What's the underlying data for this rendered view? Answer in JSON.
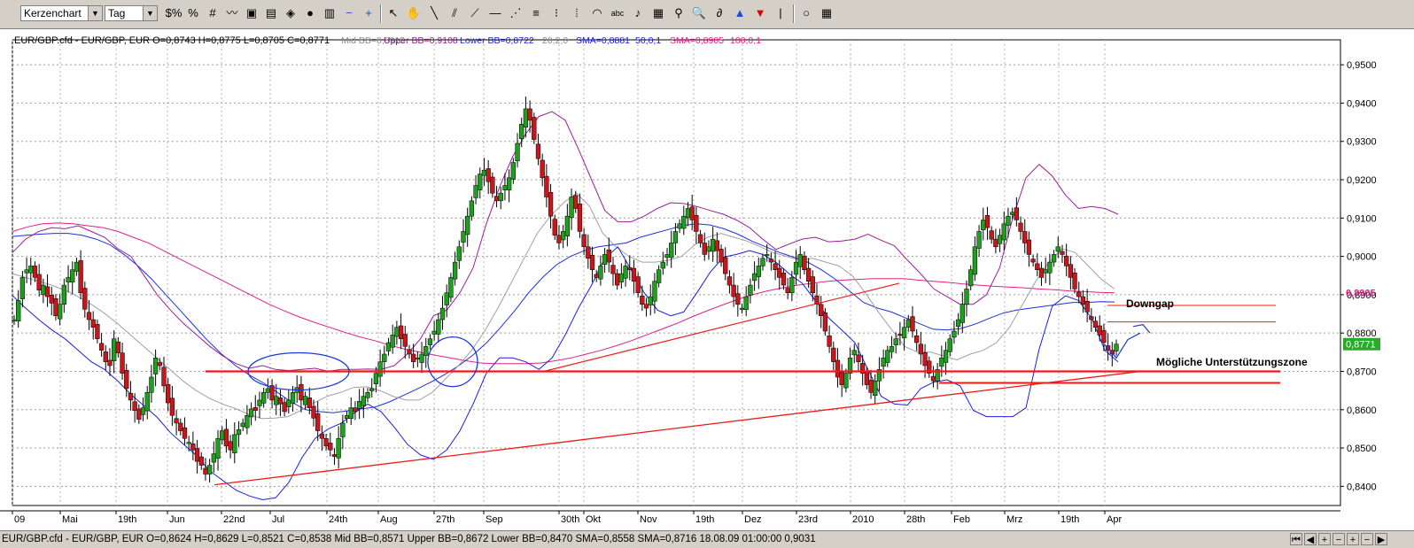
{
  "toolbar": {
    "chart_type": "Kerzenchart",
    "period": "Tag",
    "tools": [
      {
        "name": "dollar-tool-icon",
        "glyph": "$%"
      },
      {
        "name": "percent-tool-icon",
        "glyph": "%"
      },
      {
        "name": "grid-tool-icon",
        "glyph": "#"
      },
      {
        "name": "line-chart-icon",
        "glyph": "〰"
      },
      {
        "name": "print-icon",
        "glyph": "▣"
      },
      {
        "name": "image-icon",
        "glyph": "▤"
      },
      {
        "name": "eraser-icon",
        "glyph": "◈"
      },
      {
        "name": "palette-icon",
        "glyph": "●"
      },
      {
        "name": "chart-settings-icon",
        "glyph": "▥"
      },
      {
        "name": "zoom-out-icon",
        "glyph": "−"
      },
      {
        "name": "zoom-in-icon",
        "glyph": "+"
      },
      {
        "name": "pointer-icon",
        "glyph": "↖"
      },
      {
        "name": "hand-icon",
        "glyph": "✋"
      },
      {
        "name": "trendline-icon",
        "glyph": "╲"
      },
      {
        "name": "parallel-lines-icon",
        "glyph": "⫽"
      },
      {
        "name": "channel-icon",
        "glyph": "⟋"
      },
      {
        "name": "horizontal-line-icon",
        "glyph": "—"
      },
      {
        "name": "fan-icon",
        "glyph": "⋰"
      },
      {
        "name": "speed-lines-icon",
        "glyph": "≡"
      },
      {
        "name": "retracement-icon",
        "glyph": "⁝"
      },
      {
        "name": "fibonacci-icon",
        "glyph": "⦙"
      },
      {
        "name": "arc-icon",
        "glyph": "◠"
      },
      {
        "name": "text-tool-icon",
        "glyph": "abc"
      },
      {
        "name": "alarm-bell-icon",
        "glyph": "♪"
      },
      {
        "name": "calculator-icon",
        "glyph": "▦"
      },
      {
        "name": "search-icon",
        "glyph": "⚲"
      },
      {
        "name": "magnifier-icon",
        "glyph": "🔍"
      },
      {
        "name": "lasso-icon",
        "glyph": "∂"
      },
      {
        "name": "arrow-up-icon",
        "glyph": "▲"
      },
      {
        "name": "arrow-down-icon",
        "glyph": "▼"
      },
      {
        "name": "cursor-bar-icon",
        "glyph": "|"
      },
      {
        "name": "circle-icon",
        "glyph": "○"
      },
      {
        "name": "color-grid-icon",
        "glyph": "▦"
      }
    ]
  },
  "chart_data": {
    "type": "candlestick",
    "header": {
      "symbol_text": "EUR/GBP.cfd - EUR/GBP, EUR O=0,8743 H=0,8775 L=0,8705 C=0,8771",
      "midbb": "Mid BB=0,8915",
      "upperbb": "Upper BB=0,9108",
      "lowerbb": "Lower BB=0,8722",
      "bbparams": "20,2,0",
      "sma50": "SMA=0,8881",
      "sma50params": "50,0,1",
      "sma100": "SMA=0,8905",
      "sma100params": "100,0,1"
    },
    "y_range": [
      0.835,
      0.9565
    ],
    "y_ticks": [
      "0,8400",
      "0,8500",
      "0,8600",
      "0,8700",
      "0,8800",
      "0,8900",
      "0,9000",
      "0,9100",
      "0,9200",
      "0,9300",
      "0,9400",
      "0,9500"
    ],
    "x_labels": [
      "09",
      "Mai",
      "19th",
      "Jun",
      "22nd",
      "Jul",
      "24th",
      "Aug",
      "27th",
      "Sep",
      "30th",
      "Okt",
      "Nov",
      "19th",
      "Dez",
      "23rd",
      "2010",
      "28th",
      "Feb",
      "Mrz",
      "19th",
      "Apr"
    ],
    "price_marker_sma100": "0,8905",
    "price_marker_last": "0,8771",
    "annotations": {
      "downgap": "Downgap",
      "support": "Mögliche Unterstützungszone"
    },
    "bb_upper": [
      0.901,
      0.9045,
      0.9065,
      0.9075,
      0.9072,
      0.908,
      0.9065,
      0.905,
      0.902,
      0.9,
      0.895,
      0.89,
      0.886,
      0.8825,
      0.8795,
      0.8765,
      0.874,
      0.872,
      0.8708,
      0.8715,
      0.8705,
      0.8702,
      0.8705,
      0.8708,
      0.87,
      0.8705,
      0.8705,
      0.8706,
      0.8705,
      0.8715,
      0.8745,
      0.8785,
      0.8845,
      0.886,
      0.8905,
      0.897,
      0.9085,
      0.918,
      0.926,
      0.932,
      0.9365,
      0.9378,
      0.9355,
      0.928,
      0.92,
      0.912,
      0.909,
      0.909,
      0.9105,
      0.9125,
      0.914,
      0.9138,
      0.913,
      0.912,
      0.911,
      0.9095,
      0.9075,
      0.9045,
      0.9018,
      0.9032,
      0.9045,
      0.905,
      0.9038,
      0.904,
      0.9045,
      0.9058,
      0.9042,
      0.9028,
      0.899,
      0.8955,
      0.8915,
      0.8895,
      0.8875,
      0.8875,
      0.89,
      0.897,
      0.91,
      0.9205,
      0.924,
      0.921,
      0.916,
      0.9125,
      0.913,
      0.9125,
      0.911
    ],
    "bb_lower": [
      0.8898,
      0.8865,
      0.8835,
      0.8808,
      0.8785,
      0.8755,
      0.8725,
      0.8705,
      0.8675,
      0.864,
      0.861,
      0.858,
      0.854,
      0.851,
      0.848,
      0.844,
      0.8415,
      0.839,
      0.8375,
      0.8365,
      0.837,
      0.841,
      0.8475,
      0.8525,
      0.855,
      0.8565,
      0.8592,
      0.8615,
      0.8595,
      0.8555,
      0.851,
      0.8482,
      0.847,
      0.8495,
      0.8545,
      0.8615,
      0.8695,
      0.8735,
      0.8735,
      0.8725,
      0.8705,
      0.8735,
      0.8795,
      0.8865,
      0.8925,
      0.8995,
      0.9025,
      0.8965,
      0.8905,
      0.886,
      0.8845,
      0.8855,
      0.8905,
      0.8958,
      0.8998,
      0.9005,
      0.9015,
      0.9005,
      0.8985,
      0.8955,
      0.893,
      0.8885,
      0.884,
      0.8808,
      0.8775,
      0.8705,
      0.8635,
      0.8615,
      0.8612,
      0.8655,
      0.8672,
      0.8678,
      0.8662,
      0.8598,
      0.8582,
      0.8582,
      0.8582,
      0.8605,
      0.8758,
      0.887,
      0.8897,
      0.8885,
      0.8838,
      0.8755,
      0.8725
    ],
    "bb_mid": [
      0.8955,
      0.8945,
      0.8935,
      0.8925,
      0.8912,
      0.8895,
      0.8875,
      0.8852,
      0.8825,
      0.8795,
      0.8765,
      0.8735,
      0.8705,
      0.8675,
      0.865,
      0.863,
      0.8615,
      0.8603,
      0.8588,
      0.8577,
      0.8578,
      0.8582,
      0.8598,
      0.8618,
      0.8635,
      0.8645,
      0.8658,
      0.866,
      0.865,
      0.8635,
      0.8625,
      0.8625,
      0.8645,
      0.868,
      0.8715,
      0.8755,
      0.8805,
      0.8865,
      0.893,
      0.8995,
      0.906,
      0.9105,
      0.914,
      0.9165,
      0.913,
      0.906,
      0.9025,
      0.9,
      0.8985,
      0.8985,
      0.899,
      0.9,
      0.903,
      0.905,
      0.906,
      0.905,
      0.904,
      0.9025,
      0.901,
      0.9,
      0.899,
      0.8995,
      0.8985,
      0.8975,
      0.895,
      0.8905,
      0.8855,
      0.881,
      0.8765,
      0.875,
      0.875,
      0.874,
      0.873,
      0.8745,
      0.8755,
      0.8775,
      0.8815,
      0.8875,
      0.8935,
      0.8985,
      0.902,
      0.901,
      0.8975,
      0.894,
      0.8915
    ],
    "sma50": [
      0.9052,
      0.9055,
      0.9058,
      0.906,
      0.906,
      0.9055,
      0.9045,
      0.903,
      0.9005,
      0.8975,
      0.894,
      0.89,
      0.886,
      0.882,
      0.878,
      0.8745,
      0.8715,
      0.869,
      0.867,
      0.8645,
      0.862,
      0.86,
      0.8595,
      0.8592,
      0.8597,
      0.8602,
      0.8607,
      0.862,
      0.8637,
      0.8654,
      0.8672,
      0.8692,
      0.8715,
      0.8742,
      0.8775,
      0.8815,
      0.8858,
      0.8905,
      0.8945,
      0.8978,
      0.9,
      0.9015,
      0.9025,
      0.903,
      0.9035,
      0.905,
      0.906,
      0.907,
      0.908,
      0.9085,
      0.9082,
      0.9072,
      0.9058,
      0.904,
      0.9025,
      0.901,
      0.8998,
      0.8985,
      0.8965,
      0.894,
      0.891,
      0.888,
      0.8865,
      0.8855,
      0.884,
      0.8825,
      0.881,
      0.8808,
      0.8812,
      0.8823,
      0.8838,
      0.8852,
      0.886,
      0.8865,
      0.887,
      0.8875,
      0.888,
      0.888,
      0.8882,
      0.8881
    ],
    "sma100": [
      0.9065,
      0.9077,
      0.9085,
      0.9087,
      0.9085,
      0.908,
      0.9075,
      0.9065,
      0.905,
      0.9035,
      0.9015,
      0.8995,
      0.8975,
      0.8955,
      0.8935,
      0.8915,
      0.8895,
      0.8875,
      0.8858,
      0.8842,
      0.8828,
      0.8815,
      0.8802,
      0.879,
      0.878,
      0.8768,
      0.8758,
      0.875,
      0.8742,
      0.8735,
      0.8728,
      0.8722,
      0.872,
      0.872,
      0.872,
      0.8722,
      0.8728,
      0.8735,
      0.8745,
      0.8755,
      0.8767,
      0.878,
      0.8795,
      0.881,
      0.8825,
      0.8842,
      0.8858,
      0.8873,
      0.8887,
      0.89,
      0.891,
      0.8918,
      0.8925,
      0.893,
      0.8935,
      0.8938,
      0.894,
      0.8942,
      0.8942,
      0.8942,
      0.8938,
      0.8935,
      0.8932,
      0.8928,
      0.8925,
      0.8922,
      0.892,
      0.8918,
      0.8915,
      0.8913,
      0.891,
      0.8908,
      0.8906,
      0.8905
    ],
    "closes": [
      0.8835,
      0.8885,
      0.8945,
      0.8965,
      0.8975,
      0.8945,
      0.8912,
      0.8925,
      0.8895,
      0.8878,
      0.8845,
      0.8875,
      0.8925,
      0.8945,
      0.8965,
      0.8985,
      0.8905,
      0.8862,
      0.8835,
      0.8815,
      0.8785,
      0.8755,
      0.8725,
      0.8715,
      0.8785,
      0.8748,
      0.8695,
      0.8655,
      0.8625,
      0.8598,
      0.8575,
      0.8605,
      0.8645,
      0.8685,
      0.8735,
      0.8715,
      0.8662,
      0.8618,
      0.8585,
      0.8565,
      0.8545,
      0.8525,
      0.8515,
      0.8495,
      0.8465,
      0.8455,
      0.8432,
      0.8455,
      0.8485,
      0.8525,
      0.8545,
      0.8505,
      0.8495,
      0.8535,
      0.8548,
      0.8565,
      0.8585,
      0.8602,
      0.8598,
      0.8625,
      0.8645,
      0.8655,
      0.8625,
      0.8635,
      0.8615,
      0.8595,
      0.8625,
      0.8645,
      0.8658,
      0.8625,
      0.8635,
      0.8605,
      0.8578,
      0.8545,
      0.8525,
      0.8505,
      0.8495,
      0.8478,
      0.8525,
      0.8565,
      0.8585,
      0.8605,
      0.8595,
      0.8622,
      0.8635,
      0.8645,
      0.8655,
      0.8695,
      0.8725,
      0.8745,
      0.8775,
      0.8795,
      0.8815,
      0.8785,
      0.8765,
      0.8745,
      0.8725,
      0.8735,
      0.8745,
      0.8765,
      0.8785,
      0.8805,
      0.8835,
      0.8865,
      0.8905,
      0.8945,
      0.8985,
      0.9025,
      0.9065,
      0.9105,
      0.9145,
      0.9185,
      0.9215,
      0.9225,
      0.9195,
      0.9165,
      0.9145,
      0.9165,
      0.9185,
      0.9205,
      0.9245,
      0.9295,
      0.9345,
      0.9385,
      0.9355,
      0.9305,
      0.9255,
      0.9205,
      0.9155,
      0.9105,
      0.9055,
      0.9035,
      0.9065,
      0.9105,
      0.9155,
      0.9125,
      0.9065,
      0.9025,
      0.8995,
      0.8965,
      0.8945,
      0.8975,
      0.9005,
      0.8985,
      0.8955,
      0.8925,
      0.8955,
      0.8975,
      0.8965,
      0.8935,
      0.8905,
      0.8875,
      0.8865,
      0.8895,
      0.8935,
      0.8965,
      0.8985,
      0.9005,
      0.9035,
      0.9065,
      0.9085,
      0.9105,
      0.9125,
      0.9095,
      0.9065,
      0.9035,
      0.9005,
      0.9025,
      0.9045,
      0.9015,
      0.8985,
      0.8955,
      0.8925,
      0.8895,
      0.8875,
      0.8865,
      0.8895,
      0.8925,
      0.8955,
      0.8975,
      0.8995,
      0.9005,
      0.8985,
      0.8965,
      0.8945,
      0.8925,
      0.8905,
      0.8945,
      0.8985,
      0.9005,
      0.8965,
      0.8935,
      0.8905,
      0.8875,
      0.8845,
      0.8805,
      0.8765,
      0.8725,
      0.8685,
      0.8665,
      0.8695,
      0.8735,
      0.8755,
      0.8725,
      0.8695,
      0.8665,
      0.8645,
      0.8675,
      0.8705,
      0.8735,
      0.8755,
      0.8765,
      0.8785,
      0.8795,
      0.8815,
      0.8835,
      0.8805,
      0.8775,
      0.8745,
      0.8715,
      0.8695,
      0.8675,
      0.8705,
      0.8735,
      0.8755,
      0.8785,
      0.8805,
      0.8835,
      0.8875,
      0.8915,
      0.8965,
      0.9025,
      0.9065,
      0.9095,
      0.9075,
      0.9045,
      0.9025,
      0.9055,
      0.9085,
      0.9105,
      0.9115,
      0.9095,
      0.9065,
      0.9035,
      0.9005,
      0.8985,
      0.8965,
      0.8945,
      0.8965,
      0.8985,
      0.9005,
      0.9025,
      0.9005,
      0.8975,
      0.8945,
      0.8915,
      0.8895,
      0.8875,
      0.8855,
      0.8835,
      0.8815,
      0.8795,
      0.8775,
      0.8755,
      0.8745,
      0.8771
    ]
  },
  "status": {
    "text": "EUR/GBP.cfd - EUR/GBP, EUR O=0,8624 H=0,8629 L=0,8521 C=0,8538 Mid BB=0,8571 Upper BB=0,8672 Lower BB=0,8470 SMA=0,8558 SMA=0,8716  18.08.09 01:00:00  0,9031"
  }
}
